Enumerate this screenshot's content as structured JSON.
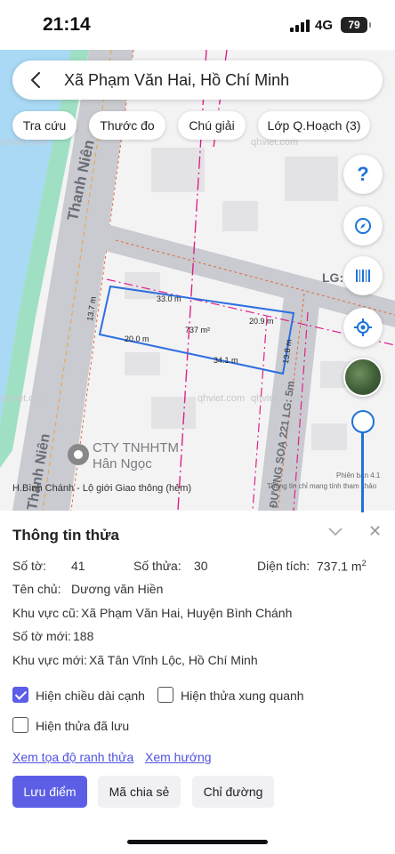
{
  "status_bar": {
    "time": "21:14",
    "network": "4G",
    "battery": "79"
  },
  "search": {
    "text": "Xã Phạm Văn Hai, Hồ Chí Minh"
  },
  "chips": [
    "Tra cứu",
    "Thước đo",
    "Chú giải",
    "Lớp Q.Hoạch (3)"
  ],
  "map": {
    "watermarks": [
      "qhviet.com",
      "qhviet.com",
      "qhviet.com",
      "qhviet.com",
      "qhviet.com"
    ],
    "road_thanh_nien": "Thanh Niên",
    "road_thanh_nien_2": "Thanh Niên",
    "road_lg": "LG:",
    "road_soa": "ĐƯỜNG SOẠ 221  LG: 5m",
    "edge_top": "33.0 m",
    "edge_right_top": "20.9 m",
    "edge_left": "13.7 m",
    "edge_bottom_left": "20.0 m",
    "edge_bottom": "34.1 m",
    "edge_right": "13.8 m",
    "area": "737 m²",
    "poi_name_1": "CTY TNHHTM",
    "poi_name_2": "Hân Ngọc",
    "road_note": "H.Bình Chánh - Lộ giới Giao thông (hẻm)",
    "version": "Phiên bản 4.1",
    "disclaimer": "Thông tin chỉ mang tính tham khảo"
  },
  "sheet": {
    "title": "Thông tin thửa",
    "so_to_label": "Số tờ:",
    "so_to_value": "41",
    "so_thua_label": "Số thửa:",
    "so_thua_value": "30",
    "dien_tich_label": "Diện tích:",
    "dien_tich_value": "737.1 m",
    "dien_tich_unit_sup": "2",
    "chu_label": "Tên chủ:",
    "chu_value": "Dương văn Hiền",
    "kv_cu_label": "Khu vực cũ:",
    "kv_cu_value": "Xã Phạm Văn Hai, Huyện Bình Chánh",
    "so_to_moi_label": "Số tờ mới:",
    "so_to_moi_value": "188",
    "kv_moi_label": "Khu vực mới:",
    "kv_moi_value": "Xã Tân Vĩnh Lộc, Hồ Chí Minh",
    "cb_edge_length": "Hiện chiều dài cạnh",
    "cb_edge_length_checked": true,
    "cb_neighbors": "Hiện thửa xung quanh",
    "cb_neighbors_checked": false,
    "cb_saved": "Hiện thửa đã lưu",
    "cb_saved_checked": false,
    "link_coords": "Xem tọa độ ranh thửa",
    "link_direction": "Xem hướng",
    "btn_save": "Lưu điểm",
    "btn_share": "Mã chia sẻ",
    "btn_route": "Chỉ đường"
  },
  "colors": {
    "accent": "#5c5fe6",
    "map_blue": "#1e73d8",
    "parcel": "#2f6fe0",
    "plan_pink": "#e0208a"
  }
}
